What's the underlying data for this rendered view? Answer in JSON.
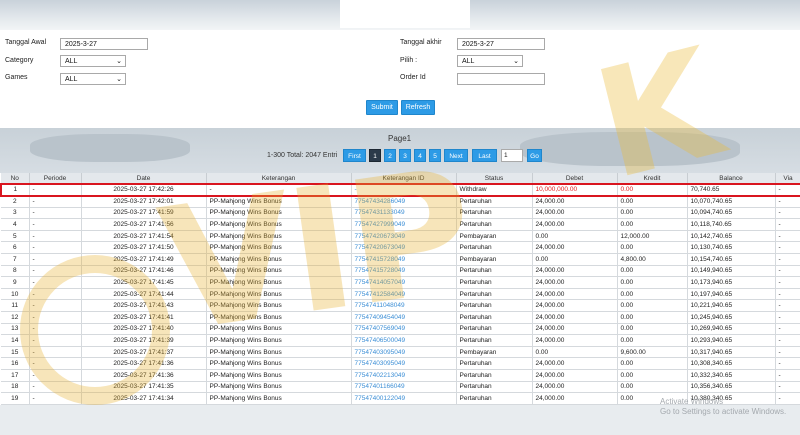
{
  "filters": {
    "tanggal_awal_label": "Tanggal Awal",
    "tanggal_awal_value": "2025-3-27",
    "tanggal_akhir_label": "Tanggal akhir",
    "tanggal_akhir_value": "2025-3-27",
    "category_label": "Category",
    "category_value": "ALL",
    "pilih_label": "Pilih :",
    "pilih_value": "ALL",
    "games_label": "Games",
    "games_value": "ALL",
    "order_id_label": "Order Id",
    "order_id_value": ""
  },
  "buttons": {
    "submit": "Submit",
    "refresh": "Refresh"
  },
  "pagination": {
    "page_label": "Page1",
    "total_label": "1-300 Total: 2047 Entri",
    "first": "First",
    "p1": "1",
    "p2": "2",
    "p3": "3",
    "p4": "4",
    "p5": "5",
    "next": "Next",
    "last": "Last",
    "page_input": "1",
    "go": "Go"
  },
  "table": {
    "headers": [
      "No",
      "Periode",
      "Date",
      "Keterangan",
      "Keterangan ID",
      "Status",
      "Debet",
      "Kredit",
      "Balance",
      "Via"
    ],
    "rows": [
      [
        "1",
        "-",
        "2025-03-27 17:42:26",
        "-",
        "-",
        "Withdraw",
        "10,000,000.00",
        "0.00",
        "70,740.65",
        "-"
      ],
      [
        "2",
        "-",
        "2025-03-27 17:42:01",
        "PP-Mahjong Wins Bonus",
        "77547434286049",
        "Pertaruhan",
        "24,000.00",
        "0.00",
        "10,070,740.65",
        "-"
      ],
      [
        "3",
        "-",
        "2025-03-27 17:41:59",
        "PP-Mahjong Wins Bonus",
        "77547431133049",
        "Pertaruhan",
        "24,000.00",
        "0.00",
        "10,094,740.65",
        "-"
      ],
      [
        "4",
        "-",
        "2025-03-27 17:41:56",
        "PP-Mahjong Wins Bonus",
        "77547427999049",
        "Pertaruhan",
        "24,000.00",
        "0.00",
        "10,118,740.65",
        "-"
      ],
      [
        "5",
        "-",
        "2025-03-27 17:41:54",
        "PP-Mahjong Wins Bonus",
        "77547420673049",
        "Pembayaran",
        "0.00",
        "12,000.00",
        "10,142,740.65",
        "-"
      ],
      [
        "6",
        "-",
        "2025-03-27 17:41:50",
        "PP-Mahjong Wins Bonus",
        "77547420673049",
        "Pertaruhan",
        "24,000.00",
        "0.00",
        "10,130,740.65",
        "-"
      ],
      [
        "7",
        "-",
        "2025-03-27 17:41:49",
        "PP-Mahjong Wins Bonus",
        "77547415728049",
        "Pembayaran",
        "0.00",
        "4,800.00",
        "10,154,740.65",
        "-"
      ],
      [
        "8",
        "-",
        "2025-03-27 17:41:46",
        "PP-Mahjong Wins Bonus",
        "77547415728049",
        "Pertaruhan",
        "24,000.00",
        "0.00",
        "10,149,940.65",
        "-"
      ],
      [
        "9",
        "-",
        "2025-03-27 17:41:45",
        "PP-Mahjong Wins Bonus",
        "77547414057049",
        "Pertaruhan",
        "24,000.00",
        "0.00",
        "10,173,940.65",
        "-"
      ],
      [
        "10",
        "-",
        "2025-03-27 17:41:44",
        "PP-Mahjong Wins Bonus",
        "77547412584049",
        "Pertaruhan",
        "24,000.00",
        "0.00",
        "10,197,940.65",
        "-"
      ],
      [
        "11",
        "-",
        "2025-03-27 17:41:43",
        "PP-Mahjong Wins Bonus",
        "77547411048049",
        "Pertaruhan",
        "24,000.00",
        "0.00",
        "10,221,940.65",
        "-"
      ],
      [
        "12",
        "-",
        "2025-03-27 17:41:41",
        "PP-Mahjong Wins Bonus",
        "77547409454049",
        "Pertaruhan",
        "24,000.00",
        "0.00",
        "10,245,940.65",
        "-"
      ],
      [
        "13",
        "-",
        "2025-03-27 17:41:40",
        "PP-Mahjong Wins Bonus",
        "77547407569049",
        "Pertaruhan",
        "24,000.00",
        "0.00",
        "10,269,940.65",
        "-"
      ],
      [
        "14",
        "-",
        "2025-03-27 17:41:39",
        "PP-Mahjong Wins Bonus",
        "77547406500049",
        "Pertaruhan",
        "24,000.00",
        "0.00",
        "10,293,940.65",
        "-"
      ],
      [
        "15",
        "-",
        "2025-03-27 17:41:37",
        "PP-Mahjong Wins Bonus",
        "77547403095049",
        "Pembayaran",
        "0.00",
        "9,600.00",
        "10,317,940.65",
        "-"
      ],
      [
        "16",
        "-",
        "2025-03-27 17:41:36",
        "PP-Mahjong Wins Bonus",
        "77547403095049",
        "Pertaruhan",
        "24,000.00",
        "0.00",
        "10,308,340.65",
        "-"
      ],
      [
        "17",
        "-",
        "2025-03-27 17:41:36",
        "PP-Mahjong Wins Bonus",
        "77547402213049",
        "Pertaruhan",
        "24,000.00",
        "0.00",
        "10,332,340.65",
        "-"
      ],
      [
        "18",
        "-",
        "2025-03-27 17:41:35",
        "PP-Mahjong Wins Bonus",
        "77547401166049",
        "Pertaruhan",
        "24,000.00",
        "0.00",
        "10,356,340.65",
        "-"
      ],
      [
        "19",
        "-",
        "2025-03-27 17:41:34",
        "PP-Mahjong Wins Bonus",
        "77547400122049",
        "Pertaruhan",
        "24,000.00",
        "0.00",
        "10,380,340.65",
        "-"
      ]
    ]
  },
  "watermark": {
    "text": "VIP",
    "text2": "K"
  },
  "os_overlay": {
    "line1": "Activate Windows",
    "line2": "Go to Settings to activate Windows."
  },
  "colors": {
    "accent": "#2d9be6",
    "highlight": "#d9151f",
    "link": "#3d8fd6"
  }
}
